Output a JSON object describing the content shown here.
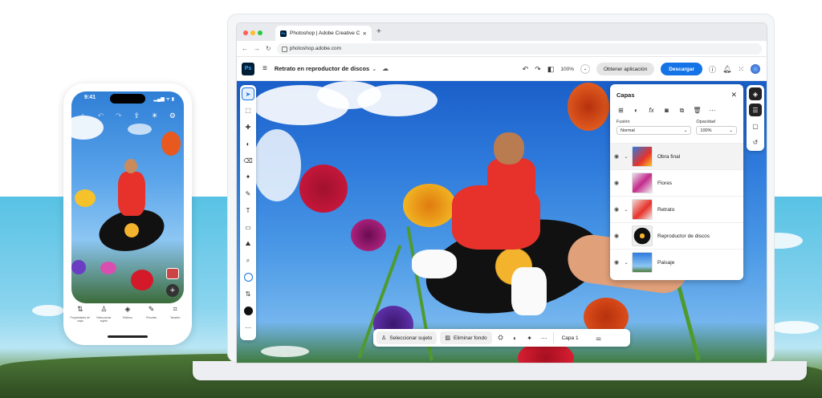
{
  "colors": {
    "accent": "#1473e6",
    "ps_logo_bg": "#001e36",
    "ps_logo_fg": "#31a8ff"
  },
  "phone": {
    "time": "9:41",
    "status": "▂▄▆ ᯤ ▮",
    "icons": [
      "home-icon",
      "undo-icon",
      "redo-icon",
      "share-icon",
      "idea-icon",
      "gear-icon"
    ],
    "bottom_tools": [
      {
        "icon": "adjust-icon",
        "label": "Propiedades de capa"
      },
      {
        "icon": "person-icon",
        "label": "Seleccionar sujeto"
      },
      {
        "icon": "fill-icon",
        "label": "Relleno"
      },
      {
        "icon": "brush-icon",
        "label": "Pinceles"
      },
      {
        "icon": "crop-icon",
        "label": "Tamaño"
      }
    ]
  },
  "browser": {
    "tab_title": "Photoshop | Adobe Creative C",
    "tab_favicon": "Ps",
    "url": "photoshop.adobe.com"
  },
  "app": {
    "logo": "Ps",
    "document_title": "Retrato en reproductor de discos",
    "zoom": "100%",
    "get_app_label": "Obtener aplicación",
    "download_label": "Descargar"
  },
  "layers_panel": {
    "title": "Capas",
    "blend_label": "Fusión",
    "blend_value": "Normal",
    "opacity_label": "Opacidad",
    "opacity_value": "100%",
    "layers": [
      {
        "name": "Obra final",
        "group": true
      },
      {
        "name": "Flores",
        "group": false
      },
      {
        "name": "Retrato",
        "group": true
      },
      {
        "name": "Reproductor de discos",
        "group": false
      },
      {
        "name": "Paisaje",
        "group": true
      }
    ]
  },
  "context_bar": {
    "select_subject": "Seleccionar sujeto",
    "remove_bg": "Eliminar fondo",
    "layer_name": "Capa 1"
  }
}
